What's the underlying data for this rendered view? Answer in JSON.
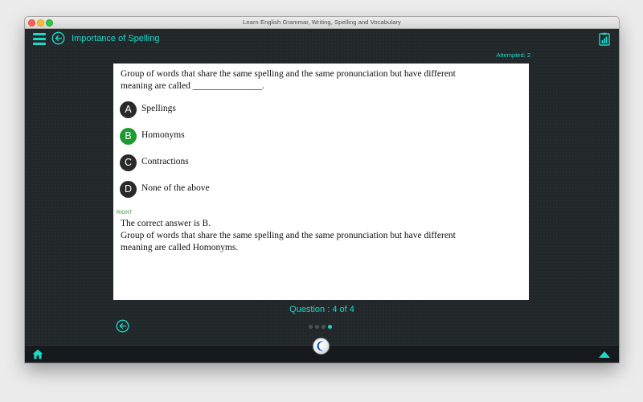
{
  "window": {
    "title": "Learn English Grammar, Writing, Spelling and Vocabulary"
  },
  "header": {
    "title": "Importance of Spelling",
    "icons": {
      "menu": "hamburger-menu-icon",
      "back": "back-arrow-circle-icon",
      "report": "clipboard-chart-icon"
    }
  },
  "status": {
    "attempted": "Attempted: 2"
  },
  "quiz": {
    "question": "Group of words that share the same spelling and the same pronunciation but have different meaning are called _______________.",
    "options": [
      {
        "letter": "A",
        "text": "Spellings"
      },
      {
        "letter": "B",
        "text": "Homonyms"
      },
      {
        "letter": "C",
        "text": "Contractions"
      },
      {
        "letter": "D",
        "text": "None of the above"
      }
    ],
    "result": "RIGHT",
    "answer_line": "The correct answer is B.",
    "explanation": "Group of words that share the same spelling and the same pronunciation but have different meaning are called Homonyms."
  },
  "pager": {
    "label": "Question : 4 of 4",
    "total_dots": 4,
    "active_dot": 4
  },
  "footer": {
    "icons": {
      "home": "home-icon",
      "logo": "app-logo-icon",
      "up": "up-triangle-icon"
    }
  },
  "colors": {
    "accent": "#1ed8c8",
    "correct": "#1e9a32",
    "badge": "#2a2a2a",
    "background": "#22272a"
  }
}
